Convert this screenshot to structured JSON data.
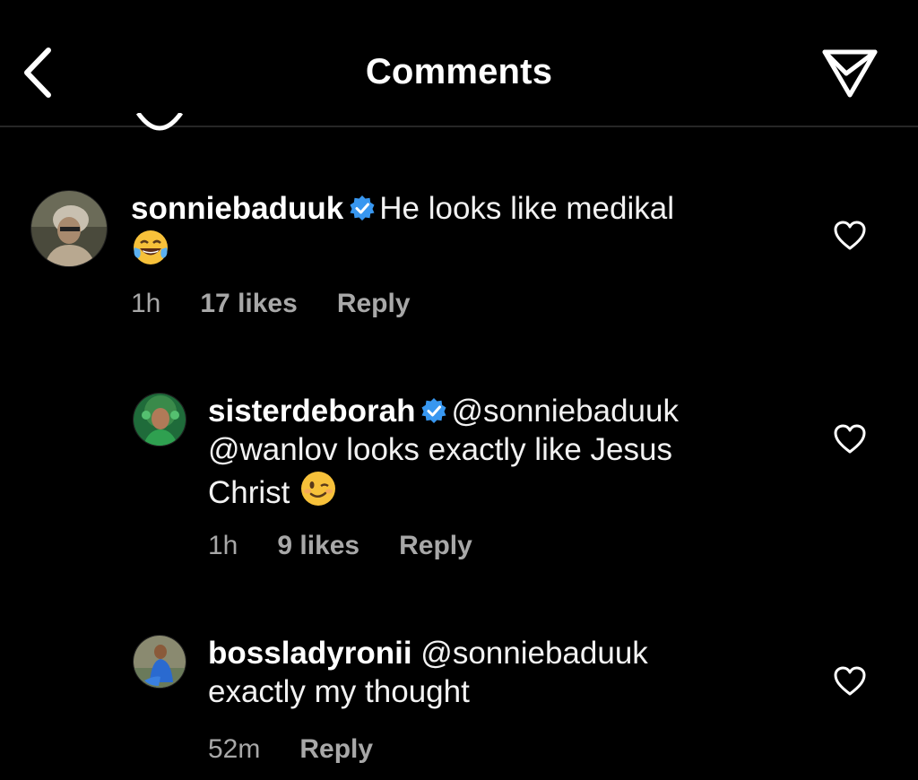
{
  "header": {
    "title": "Comments",
    "back_icon": "chevron-left-icon",
    "share_icon": "paper-plane-icon"
  },
  "comments": [
    {
      "username": "sonniebaduuk",
      "verified": true,
      "text": "He looks like medikal",
      "emoji": "tears-of-joy-emoji",
      "time": "1h",
      "likes": "17 likes",
      "reply": "Reply"
    },
    {
      "username": "sisterdeborah",
      "verified": true,
      "mention": "@sonniebaduuk",
      "line2": "@wanlov looks exactly like Jesus",
      "line3": "Christ",
      "emoji": "winking-face-emoji",
      "time": "1h",
      "likes": "9 likes",
      "reply": "Reply"
    },
    {
      "username": "bossladyronii",
      "verified": false,
      "mention": "@sonniebaduuk",
      "line2": "exactly my thought",
      "time": "52m",
      "reply": "Reply"
    }
  ],
  "colors": {
    "background": "#000000",
    "text": "#ffffff",
    "meta": "#a8a8a8",
    "verified": "#3897f0",
    "divider": "#262626"
  }
}
